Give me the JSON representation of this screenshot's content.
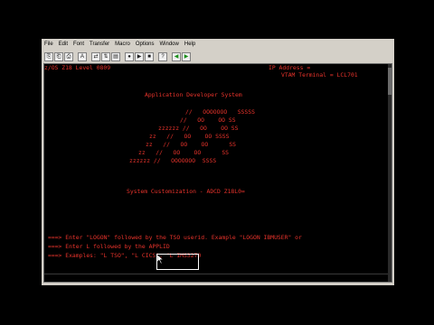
{
  "menu": [
    "File",
    "Edit",
    "Font",
    "Transfer",
    "Macro",
    "Options",
    "Window",
    "Help"
  ],
  "toolbar_icons": [
    {
      "name": "copy-icon",
      "glyph": "⎘"
    },
    {
      "name": "paste-icon",
      "glyph": "⎗"
    },
    {
      "name": "print-icon",
      "glyph": "⎙"
    },
    {
      "name": "font-icon",
      "glyph": "A"
    },
    {
      "name": "connect-icon",
      "glyph": "⇄"
    },
    {
      "name": "transfer-icon",
      "glyph": "⇅"
    },
    {
      "name": "macro-icon",
      "glyph": "▤"
    },
    {
      "name": "record-icon",
      "glyph": "●"
    },
    {
      "name": "play-icon",
      "glyph": "▶"
    },
    {
      "name": "stop-icon",
      "glyph": "■"
    },
    {
      "name": "help-icon",
      "glyph": "?"
    },
    {
      "name": "back-icon",
      "glyph": "◀"
    },
    {
      "name": "forward-icon",
      "glyph": "▶"
    }
  ],
  "terminal": {
    "header_left": "z/OS Z18 Level 0809",
    "header_ip": "IP Address =",
    "header_vtam": "VTAM Terminal = LCL701",
    "title": "Application Developer System",
    "logo": [
      "//   OOOOOOO   SSSSS",
      "//   OO    OO SS",
      "zzzzzz //   OO    OO SS",
      "zz   //   OO    OO SSSS",
      "zz   //   OO    OO      SS",
      "zz   //   OO    OO      SS",
      "zzzzzz //   OOOOOOO  SSSS"
    ],
    "customization": "System Customization - ADCD Z18L0=",
    "messages": [
      "===> Enter \"LOGON\" followed by the TSO userid. Example \"LOGON IBMUSER\" or",
      "===> Enter L followed by the APPLID",
      "===> Examples: \"L TSO\", \"L CICS\", \"L IMS3270"
    ]
  }
}
